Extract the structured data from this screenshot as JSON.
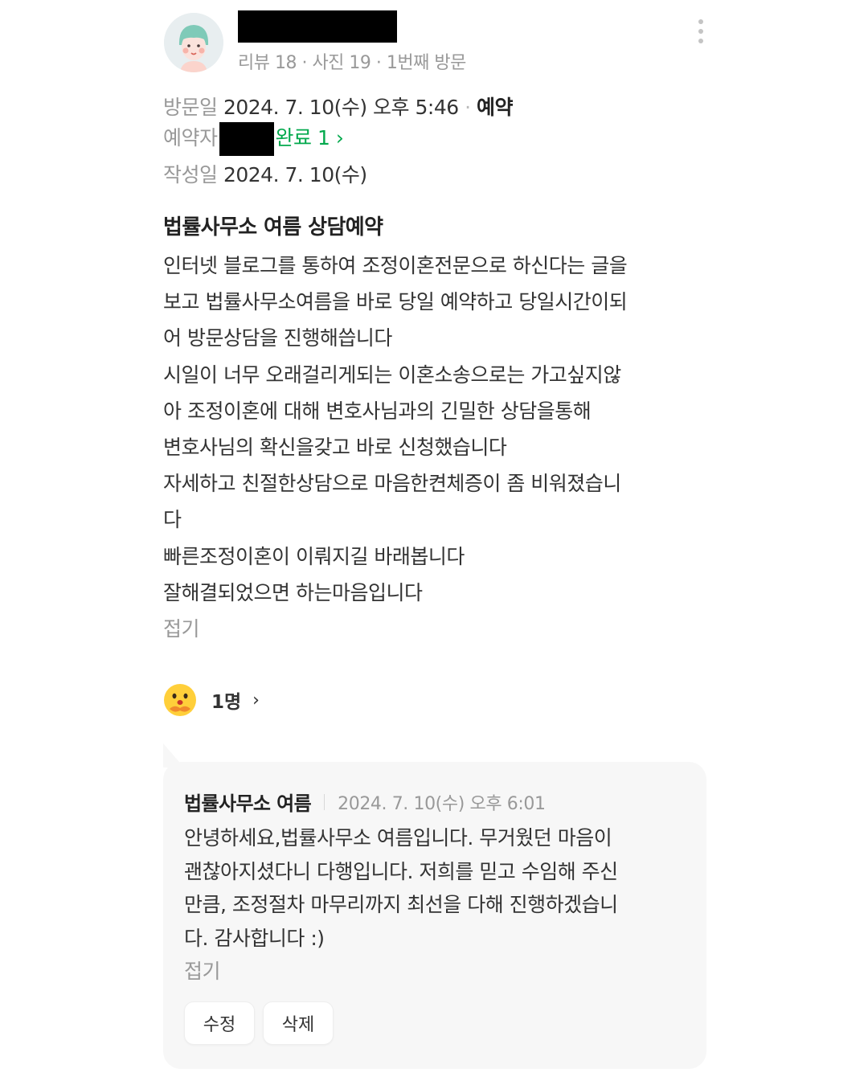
{
  "reviewer": {
    "stats": "리뷰 18 · 사진 19 · 1번째 방문"
  },
  "visit": {
    "label": "방문일",
    "date": "2024. 7. 10(수) 오후 5:46",
    "type": "예약"
  },
  "booker": {
    "label": "예약자",
    "status": "완료 1",
    "chevron": "›"
  },
  "written": {
    "label": "작성일",
    "date": "2024. 7. 10(수)"
  },
  "review": {
    "title": "법률사무소 여름 상담예약",
    "lines": [
      "인터넷 블로그를 통하여 조정이혼전문으로 하신다는 글을",
      "보고 법률사무소여름을 바로 당일 예약하고 당일시간이되",
      "어 방문상담을 진행해씁니다",
      "시일이 너무 오래걸리게되는 이혼소송으로는 가고싶지않",
      "아 조정이혼에 대해 변호사님과의 긴밀한 상담을통해",
      "변호사님의 확신을갖고 바로 신청했습니다",
      "자세하고 친절한상담으로 마음한켠체증이 좀 비워졌습니",
      "다",
      "빠른조정이혼이 이뤄지길 바래봅니다",
      "잘해결되었으면 하는마음입니다"
    ],
    "fold": "접기"
  },
  "reaction": {
    "count": "1명",
    "chevron": "›"
  },
  "owner_reply": {
    "name": "법률사무소 여름",
    "date": "2024. 7. 10(수) 오후 6:01",
    "lines": [
      "안녕하세요,법률사무소 여름입니다. 무거웠던 마음이",
      "괜찮아지셨다니 다행입니다. 저희를 믿고 수임해 주신",
      "만큼, 조정절차 마무리까지 최선을 다해 진행하겠습니",
      "다. 감사합니다 :)"
    ],
    "fold": "접기",
    "edit_label": "수정",
    "delete_label": "삭제"
  },
  "colors": {
    "accent_green": "#03a94d",
    "muted": "#999999",
    "reply_bg": "#f7f7f7"
  },
  "icons": [
    "avatar",
    "more-vertical-icon",
    "emoji-reaction-icon",
    "chevron-right-icon"
  ]
}
